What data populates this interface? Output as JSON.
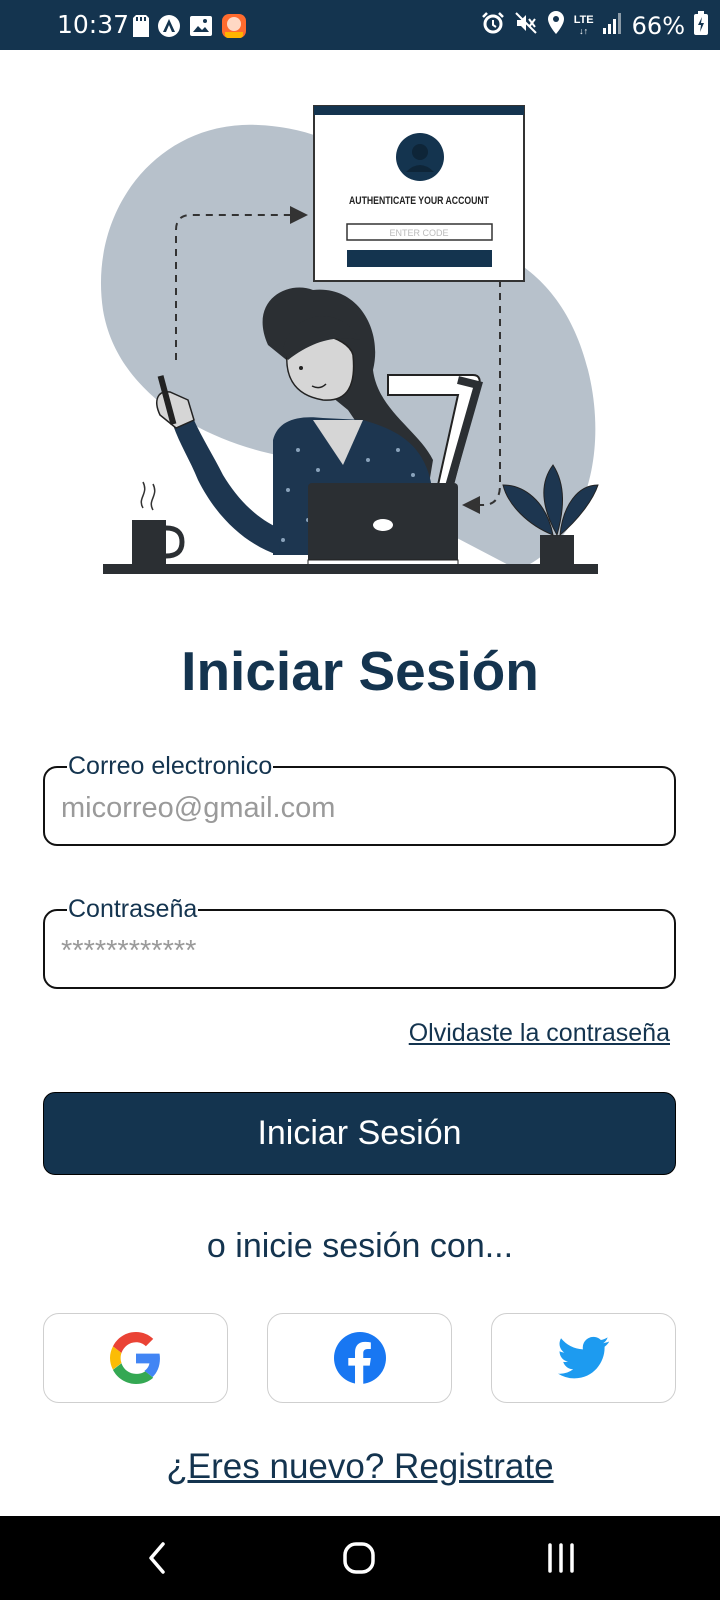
{
  "status_bar": {
    "time": "10:37",
    "battery": "66%",
    "icons_left": [
      "sd-card-icon",
      "app-icon",
      "gallery-icon",
      "notification-app-icon"
    ],
    "icons_right": [
      "alarm-icon",
      "mute-icon",
      "location-icon",
      "lte-icon",
      "signal-icon",
      "battery-icon"
    ],
    "network_label": "LTE"
  },
  "illustration": {
    "card_title": "AUTHENTICATE YOUR ACCOUNT",
    "card_input_placeholder": "ENTER CODE"
  },
  "title": "Iniciar Sesión",
  "email_field": {
    "label": "Correo electronico",
    "placeholder": "micorreo@gmail.com"
  },
  "password_field": {
    "label": "Contraseña",
    "placeholder": "************"
  },
  "forgot_password": "Olvidaste la contraseña",
  "login_button": "Iniciar Sesión",
  "or_text": "o inicie sesión con...",
  "social": [
    "google",
    "facebook",
    "twitter"
  ],
  "register_link": "¿Eres nuevo? Registrate",
  "colors": {
    "primary": "#14344f",
    "status_bar": "#14344f",
    "nav_bar": "#000000",
    "blob": "#b7c1cb",
    "google_blue": "#4285f4",
    "google_red": "#ea4335",
    "google_yellow": "#fbbc05",
    "google_green": "#34a853",
    "facebook": "#1877f2",
    "twitter": "#1d9bf0"
  }
}
